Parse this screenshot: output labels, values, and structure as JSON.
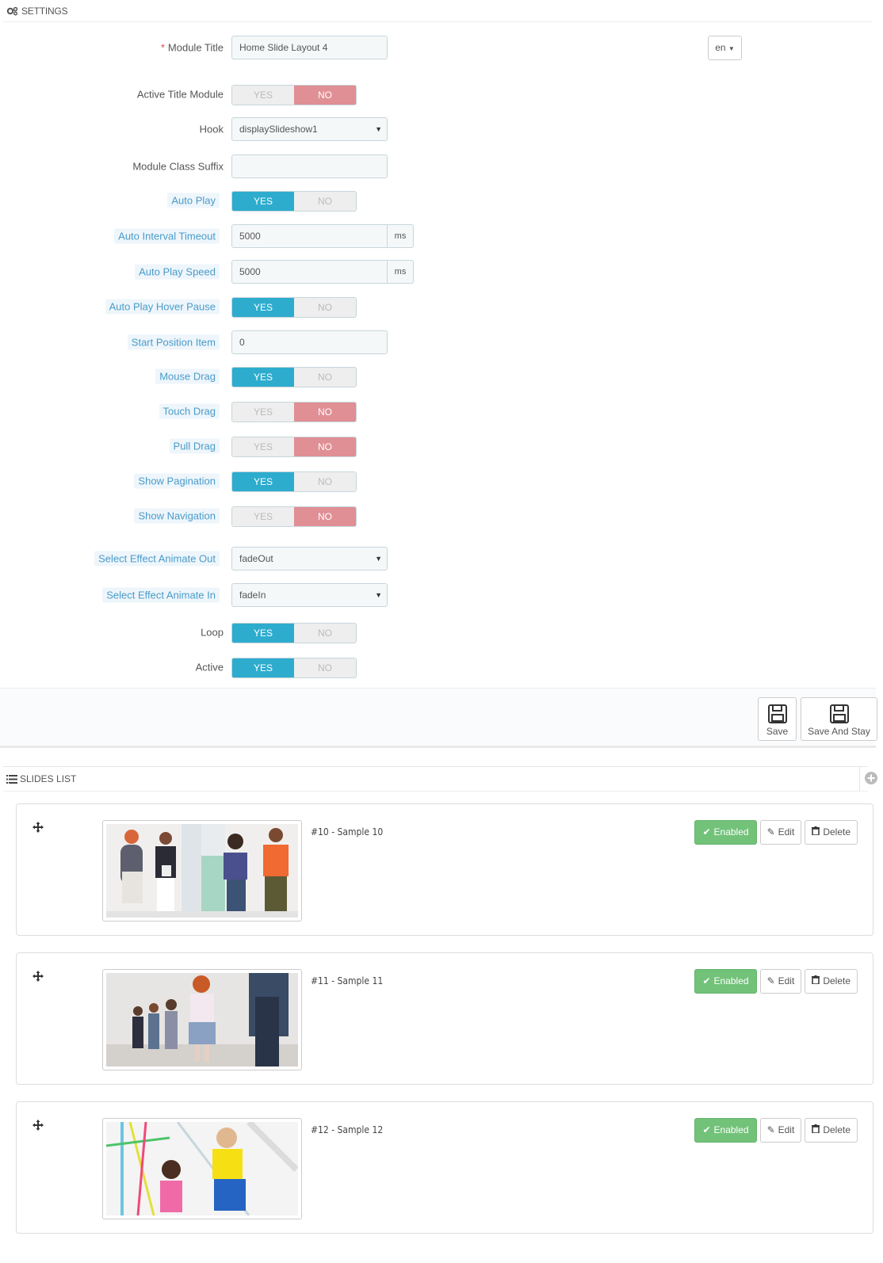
{
  "settings": {
    "heading": "SETTINGS",
    "lang": "en",
    "fields": {
      "module_title": {
        "label": "Module Title",
        "value": "Home Slide Layout 4"
      },
      "active_title_module": {
        "label": "Active Title Module",
        "yes": "YES",
        "no": "NO",
        "state": "no"
      },
      "hook": {
        "label": "Hook",
        "value": "displaySlideshow1"
      },
      "module_class_suffix": {
        "label": "Module Class Suffix",
        "value": ""
      },
      "auto_play": {
        "label": "Auto Play",
        "yes": "YES",
        "no": "NO",
        "state": "yes"
      },
      "auto_interval_timeout": {
        "label": "Auto Interval Timeout",
        "value": "5000",
        "unit": "ms"
      },
      "auto_play_speed": {
        "label": "Auto Play Speed",
        "value": "5000",
        "unit": "ms"
      },
      "auto_play_hover_pause": {
        "label": "Auto Play Hover Pause",
        "yes": "YES",
        "no": "NO",
        "state": "yes"
      },
      "start_position_item": {
        "label": "Start Position Item",
        "value": "0"
      },
      "mouse_drag": {
        "label": "Mouse Drag",
        "yes": "YES",
        "no": "NO",
        "state": "yes"
      },
      "touch_drag": {
        "label": "Touch Drag",
        "yes": "YES",
        "no": "NO",
        "state": "no"
      },
      "pull_drag": {
        "label": "Pull Drag",
        "yes": "YES",
        "no": "NO",
        "state": "no"
      },
      "show_pagination": {
        "label": "Show Pagination",
        "yes": "YES",
        "no": "NO",
        "state": "yes"
      },
      "show_navigation": {
        "label": "Show Navigation",
        "yes": "YES",
        "no": "NO",
        "state": "no"
      },
      "effect_out": {
        "label": "Select Effect Animate Out",
        "value": "fadeOut"
      },
      "effect_in": {
        "label": "Select Effect Animate In",
        "value": "fadeIn"
      },
      "loop": {
        "label": "Loop",
        "yes": "YES",
        "no": "NO",
        "state": "yes"
      },
      "active": {
        "label": "Active",
        "yes": "YES",
        "no": "NO",
        "state": "yes"
      }
    }
  },
  "footer": {
    "save": "Save",
    "save_and_stay": "Save And Stay"
  },
  "slides_list": {
    "heading": "SLIDES LIST",
    "items": [
      {
        "title": "#10 - Sample 10",
        "status": "Enabled",
        "edit": "Edit",
        "delete": "Delete"
      },
      {
        "title": "#11 - Sample 11",
        "status": "Enabled",
        "edit": "Edit",
        "delete": "Delete"
      },
      {
        "title": "#12 - Sample 12",
        "status": "Enabled",
        "edit": "Edit",
        "delete": "Delete"
      }
    ]
  },
  "colors": {
    "yes_on": "#2eacce",
    "no_on": "#e08f95",
    "enabled": "#72c279",
    "hint_label": "#4a9bc9"
  }
}
